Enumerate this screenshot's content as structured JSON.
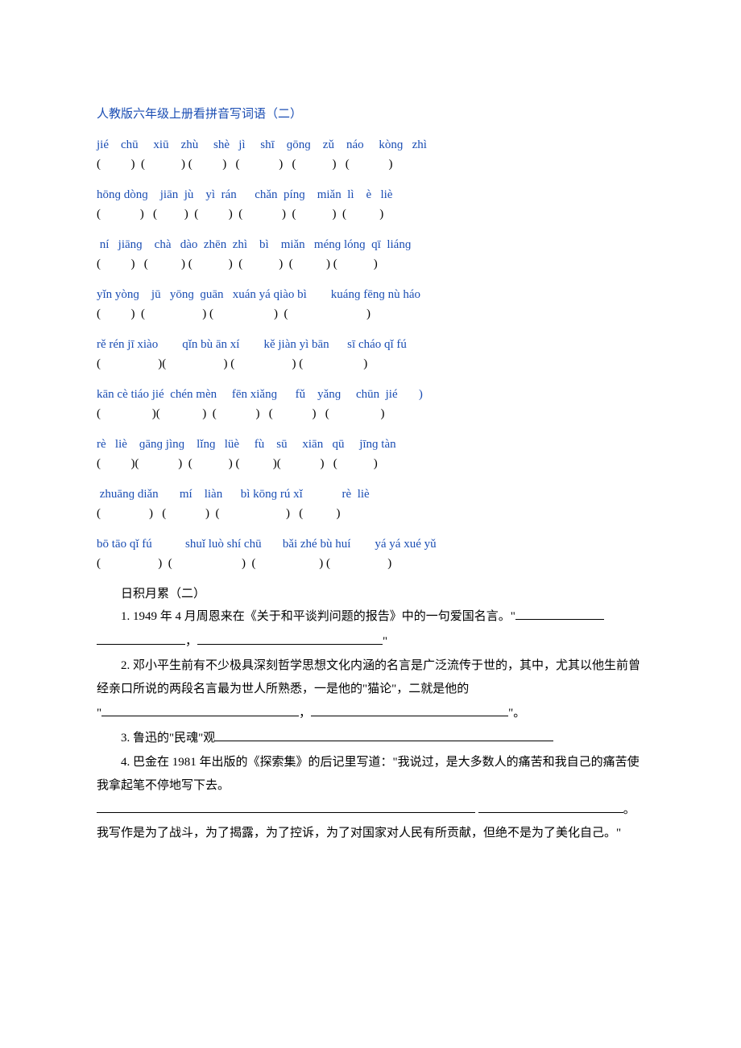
{
  "title": "人教版六年级上册看拼音写词语（二）",
  "rows": [
    {
      "pinyin": "jié    chū     xiū    zhù     shè   jì     shī    ɡōnɡ    zǔ    náo     kònɡ   zhì",
      "paren": "(          )  (            ) (          )   (             )   (            )   (             )"
    },
    {
      "pinyin": "hōnɡ dònɡ    jiān  jù    yì  rán      chǎn  pínɡ    miǎn  lì    è   liè",
      "paren": "(             )   (         )  (          )  (             )  (            )  (           )"
    },
    {
      "pinyin": " ní   jiānɡ    chà   dào  zhēn  zhì    bì    miǎn   ménɡ lónɡ  qī  liánɡ",
      "paren": "(          )   (           ) (            )  (            )  (           ) (            )"
    },
    {
      "pinyin": "yǐn yònɡ    jū   yōnɡ  ɡuān   xuán yá qiào bì        kuánɡ fēnɡ nù háo",
      "paren": "(          )  (                   ) (                    )  (                          )"
    },
    {
      "pinyin": "rě rén jī xiào        qǐn bù ān xí        kě jiàn yì bān      sī cháo qǐ fú",
      "paren": "(                   )(                   ) (                   ) (                    )"
    },
    {
      "pinyin": "kān cè tiáo jié  chén mèn     fēn xiǎnɡ      fǔ    yǎnɡ     chūn  jié       )",
      "paren": "(                 )(              )  (             )   (             )   (                 )"
    },
    {
      "pinyin": "rè   liè    ɡānɡ jìnɡ    lǐnɡ   lüè     fù    sū     xiān   qū     jīnɡ tàn",
      "paren": "(          )(             )  (            ) (           )(             )   (            )"
    },
    {
      "pinyin": " zhuānɡ diǎn       mí    liàn      bì kōnɡ rú xǐ             rè  liè",
      "paren": "(                )   (             )  (                      )   (           )"
    },
    {
      "pinyin": "bō tāo qǐ fú           shuǐ luò shí chū       bǎi zhé bù huí        yá yá xué yǔ",
      "paren": "(                   )  (                       )  (                     ) (                   )"
    }
  ],
  "accum_title": "日积月累（二）",
  "q1_a": "1. 1949 年 4 月周恩来在《关于和平谈判问题的报告》中的一句爱国名言。\"",
  "q1_b": "，",
  "q1_c": "\"",
  "q2_a": "2. 邓小平生前有不少极具深刻哲学思想文化内涵的名言是广泛流传于世的，其中，尤其以他生前曾经亲口所说的两段名言最为世人所熟悉，一是他的\"猫论\"，二就是他的",
  "q2_b": "\"",
  "q2_c": "，",
  "q2_d": "\"。",
  "q3_a": "3. 鲁迅的\"民魂\"观",
  "q4_a": "4. 巴金在 1981 年出版的《探索集》的后记里写道：\"我说过，是大多数人的痛苦和我自己的痛苦使我拿起笔不停地写下去。",
  "q4_b": "。我写作是为了战斗，为了揭露，为了控诉，为了对国家对人民有所贡献，但绝不是为了美化自己。\""
}
